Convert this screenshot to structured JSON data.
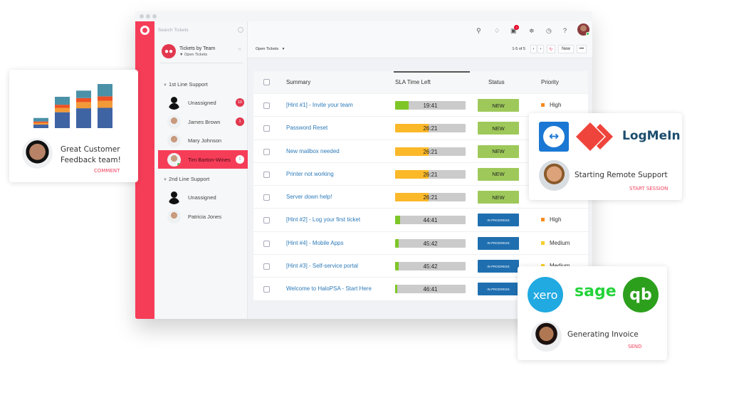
{
  "sidebar": {
    "search_placeholder": "Search Tickets",
    "view_title": "Tickets by Team",
    "view_filter": "Open Tickets",
    "groups": [
      {
        "label": "1st Line Support",
        "agents": [
          {
            "name": "Unassigned",
            "count": "10",
            "avatar": "silhouette"
          },
          {
            "name": "James Brown",
            "count": "1",
            "avatar": "photo"
          },
          {
            "name": "Mary Johnson",
            "count": "",
            "avatar": "photo"
          },
          {
            "name": "Tim Barton-Wines",
            "count": "5",
            "avatar": "photo",
            "selected": true,
            "online": true
          }
        ]
      },
      {
        "label": "2nd Line Support",
        "agents": [
          {
            "name": "Unassigned",
            "count": "",
            "avatar": "silhouette"
          },
          {
            "name": "Patricia Jones",
            "count": "",
            "avatar": "photo"
          }
        ]
      }
    ]
  },
  "topbar": {
    "icons": [
      "search-icon",
      "bell-icon",
      "clipboard-icon",
      "rss-icon",
      "clock-icon",
      "lightbulb-icon"
    ],
    "notification_count": "3"
  },
  "toolbar": {
    "filter_label": "Open Tickets",
    "pager": "1-5 of 5",
    "new_label": "New",
    "more_label": "•••"
  },
  "table": {
    "headers": {
      "summary": "Summary",
      "sla": "SLA Time Left",
      "status": "Status",
      "priority": "Priority"
    },
    "rows": [
      {
        "summary": "[Hint #1] - Invite your team",
        "sla": "19:41",
        "sla_fraction": 0.19,
        "sla_color": "#7ec628",
        "status": "NEW",
        "priority": "High"
      },
      {
        "summary": "Password Reset",
        "sla": "26:21",
        "sla_fraction": 0.47,
        "sla_color": "#fbb829",
        "status": "NEW",
        "priority": ""
      },
      {
        "summary": "New mailbox needed",
        "sla": "26:21",
        "sla_fraction": 0.47,
        "sla_color": "#fbb829",
        "status": "NEW",
        "priority": ""
      },
      {
        "summary": "Printer not working",
        "sla": "26:21",
        "sla_fraction": 0.47,
        "sla_color": "#fbb829",
        "status": "NEW",
        "priority": ""
      },
      {
        "summary": "Server down help!",
        "sla": "26:21",
        "sla_fraction": 0.47,
        "sla_color": "#fbb829",
        "status": "NEW",
        "priority": ""
      },
      {
        "summary": "[Hint #2] - Log your first ticket",
        "sla": "44:41",
        "sla_fraction": 0.07,
        "sla_color": "#7ec628",
        "status": "IN PROGRESS",
        "priority": "High"
      },
      {
        "summary": "[Hint #4] - Mobile Apps",
        "sla": "45:42",
        "sla_fraction": 0.05,
        "sla_color": "#7ec628",
        "status": "IN PROGRESS",
        "priority": "Medium"
      },
      {
        "summary": "[Hint #3] - Self-service portal",
        "sla": "45:42",
        "sla_fraction": 0.05,
        "sla_color": "#7ec628",
        "status": "IN PROGRESS",
        "priority": "Medium"
      },
      {
        "summary": "Welcome to HaloPSA - Start Here",
        "sla": "46:41",
        "sla_fraction": 0.03,
        "sla_color": "#7ec628",
        "status": "IN PROGRESS",
        "priority": ""
      }
    ],
    "priority_colors": {
      "High": "#f58a1f",
      "Medium": "#f7ce2a"
    }
  },
  "cards": {
    "feedback": {
      "message_line1": "Great Customer",
      "message_line2": "Feedback team!",
      "action": "COMMENT",
      "bars": [
        {
          "blue": 8,
          "orange": 4,
          "red": 3,
          "teal": 8
        },
        {
          "blue": 36,
          "orange": 10,
          "red": 7,
          "teal": 18
        },
        {
          "blue": 45,
          "orange": 14,
          "red": 9,
          "teal": 17
        },
        {
          "blue": 46,
          "orange": 16,
          "red": 10,
          "teal": 28
        }
      ],
      "bar_colors": {
        "blue": "#3f64a3",
        "orange": "#f29a38",
        "red": "#ee5124",
        "teal": "#4a91a8"
      }
    },
    "remote": {
      "logos": [
        "teamviewer-logo",
        "anydesk-logo",
        "LogMeIn"
      ],
      "message": "Starting Remote Support",
      "action": "START SESSION"
    },
    "invoice": {
      "logos": [
        "xero",
        "sage",
        "quickbooks-logo"
      ],
      "message": "Generating Invoice",
      "action": "SEND"
    }
  }
}
